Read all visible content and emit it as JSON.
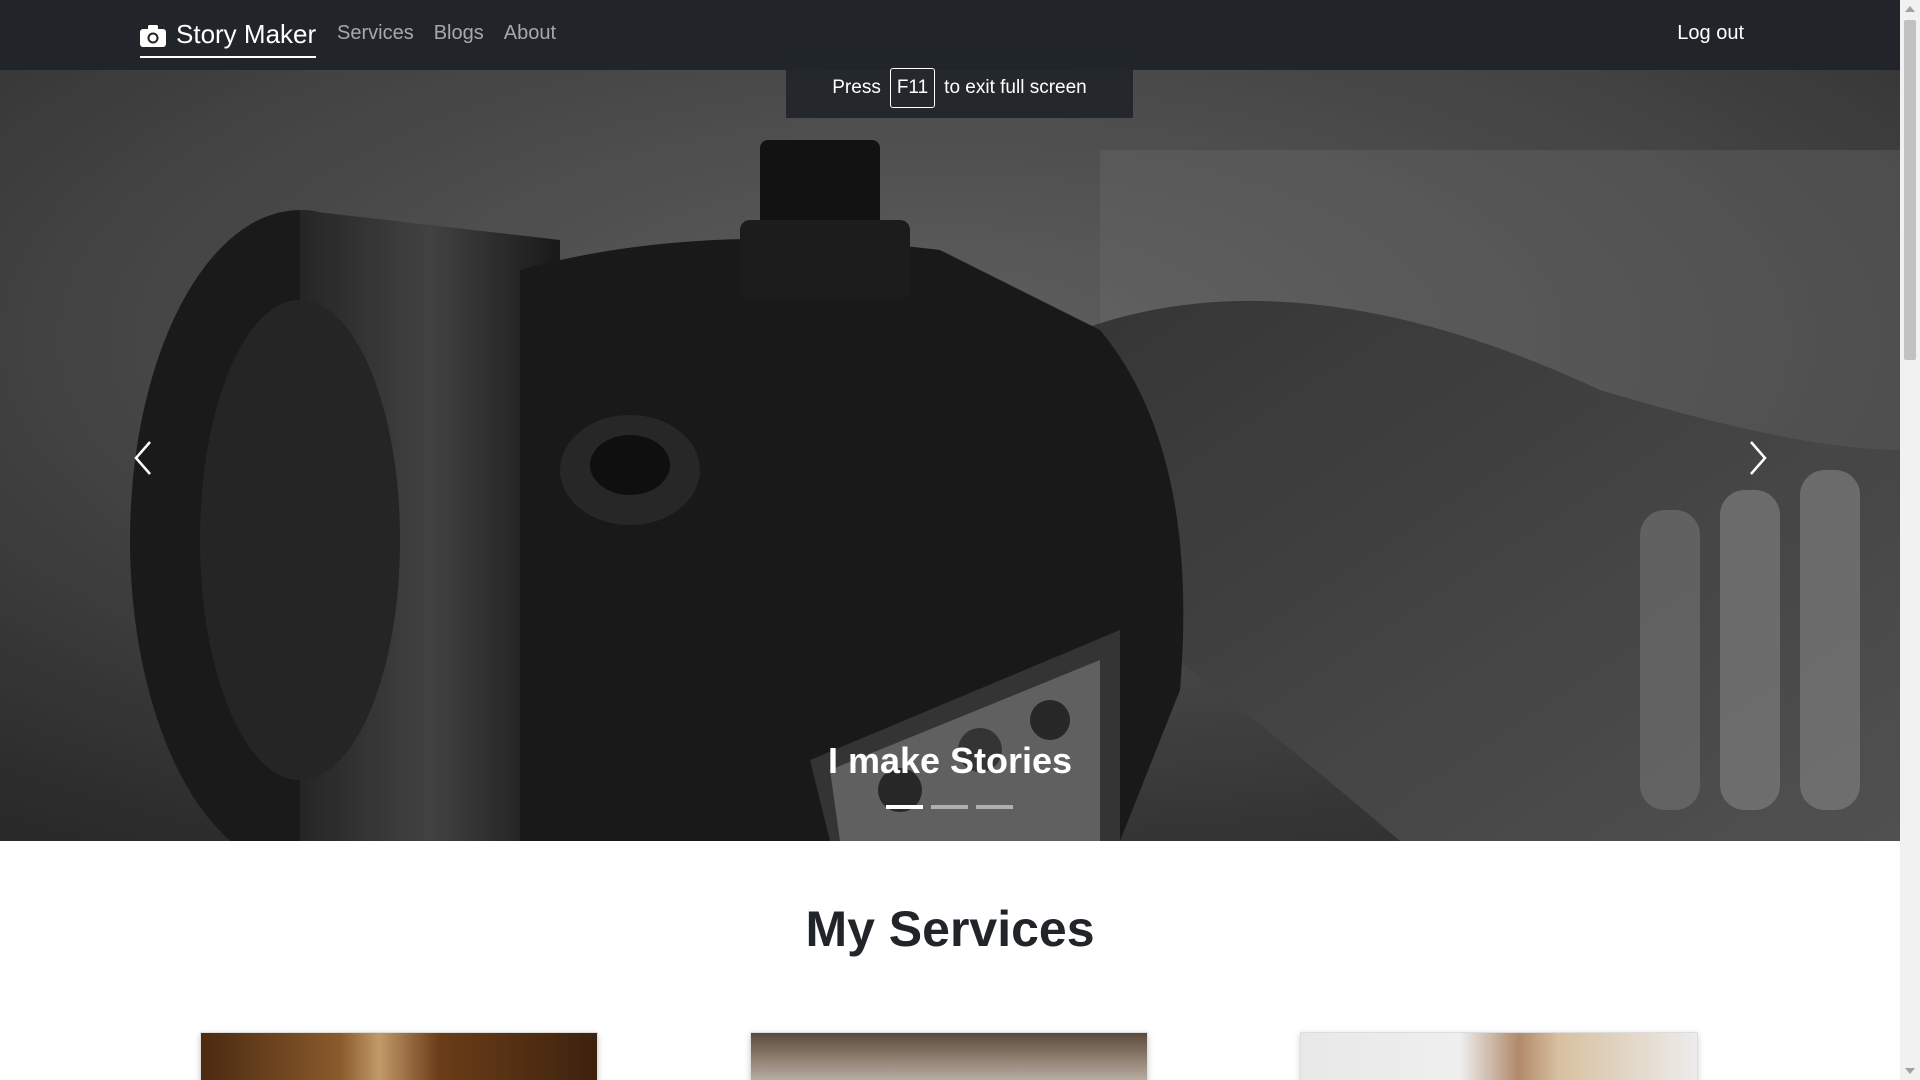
{
  "navbar": {
    "brand": "Story Maker",
    "brand_icon": "camera-icon",
    "links": [
      "Services",
      "Blogs",
      "About"
    ],
    "logout": "Log out"
  },
  "fullscreen_notice": {
    "prefix": "Press",
    "key": "F11",
    "suffix": "to exit full screen"
  },
  "hero": {
    "caption": "I make Stories",
    "slides": 3,
    "active_slide": 1,
    "prev_icon": "chevron-left-icon",
    "next_icon": "chevron-right-icon"
  },
  "services": {
    "title": "My Services"
  },
  "colors": {
    "navbar_bg": "#212529",
    "text_dark": "#212529"
  }
}
